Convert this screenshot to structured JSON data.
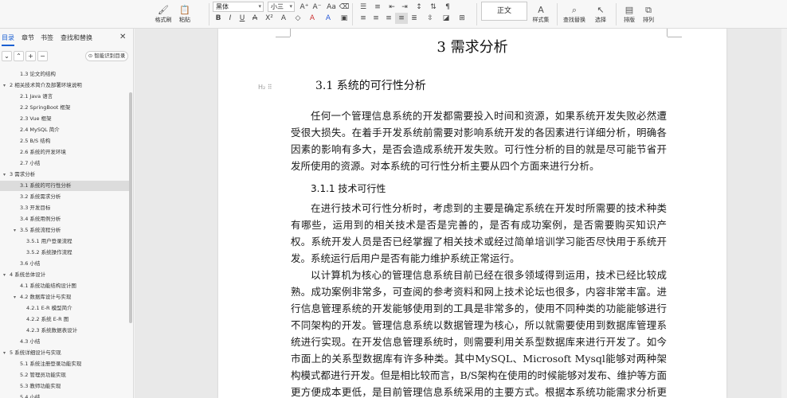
{
  "ribbon": {
    "format_painter": "格式刷",
    "paste": "粘贴",
    "font_name": "黑体",
    "font_size": "小三",
    "style_current": "正文",
    "style_set": "样式集",
    "find_replace": "查找替换",
    "select": "选择",
    "arrange_layout": "排版",
    "arrange": "排列"
  },
  "nav": {
    "tabs": [
      "目录",
      "章节",
      "书签",
      "查找和替换"
    ],
    "smart_toc": "智能识别目录",
    "toc": [
      {
        "label": "1.3 论文的结构",
        "level": 2
      },
      {
        "label": "2 相关技术简介及部署环境说明",
        "level": 1
      },
      {
        "label": "2.1 Java 语言",
        "level": 2
      },
      {
        "label": "2.2 SpringBoot 框架",
        "level": 2
      },
      {
        "label": "2.3 Vue 框架",
        "level": 2
      },
      {
        "label": "2.4 MySQL 简介",
        "level": 2
      },
      {
        "label": "2.5 B/S 结构",
        "level": 2
      },
      {
        "label": "2.6 系统的开发环境",
        "level": 2
      },
      {
        "label": "2.7 小结",
        "level": 2
      },
      {
        "label": "3 需求分析",
        "level": 1
      },
      {
        "label": "3.1 系统的可行性分析",
        "level": 2,
        "selected": true
      },
      {
        "label": "3.2 系统需求分析",
        "level": 2
      },
      {
        "label": "3.3 开发目标",
        "level": 2
      },
      {
        "label": "3.4  系统用例分析",
        "level": 2
      },
      {
        "label": "3.5 系统流程分析",
        "level": 2,
        "expandable": true
      },
      {
        "label": "3.5.1  用户登录流程",
        "level": 3
      },
      {
        "label": "3.5.2  系统操作流程",
        "level": 3
      },
      {
        "label": "3.6 小结",
        "level": 2
      },
      {
        "label": "4 系统总体设计",
        "level": 1
      },
      {
        "label": "4.1 系统功能结构设计图",
        "level": 2
      },
      {
        "label": "4.2  数据库设计与实现",
        "level": 2,
        "expandable": true
      },
      {
        "label": "4.2.1   E-R 模型简介",
        "level": 3
      },
      {
        "label": "4.2.2    系统 E-R 图",
        "level": 3
      },
      {
        "label": "4.2.3   系统数据表设计",
        "level": 3
      },
      {
        "label": "4.3 小结",
        "level": 2
      },
      {
        "label": "5 系统详细设计与实现",
        "level": 1
      },
      {
        "label": "5.1 系统注册登录功能实现",
        "level": 2
      },
      {
        "label": "5.2 管理员功能实现",
        "level": 2
      },
      {
        "label": "5.3 教师功能实现",
        "level": 2
      },
      {
        "label": "5.4 小结",
        "level": 2
      }
    ]
  },
  "document": {
    "chapter_title": "3  需求分析",
    "section_title": "3.1 系统的可行性分析",
    "heading_marker": "H₂",
    "para1": "任何一个管理信息系统的开发都需要投入时间和资源，如果系统开发失败必然遭受很大损失。在着手开发系统前需要对影响系统开发的各因素进行详细分析，明确各因素的影响有多大，是否会造成系统开发失败。可行性分析的目的就是尽可能节省开发所使用的资源。对本系统的可行性分析主要从四个方面来进行分析。",
    "subsection_title": "3.1.1    技术可行性",
    "para2": "在进行技术可行性分析时，考虑到的主要是确定系统在开发时所需要的技术种类有哪些，运用到的相关技术是否是完善的，是否有成功案例，是否需要购买知识产权。系统开发人员是否已经掌握了相关技术或经过简单培训学习能否尽快用于系统开发。系统运行后用户是否有能力维护系统正常运行。",
    "para3": "以计算机为核心的管理信息系统目前已经在很多领域得到运用，技术已经比较成熟。成功案例非常多，可查阅的参考资料和网上技术论坛也很多，内容非常丰富。进行信息管理系统的开发能够使用到的工具是非常多的，使用不同种类的功能能够进行不同架构的开发。管理信息系统以数据管理为核心，所以就需要使用到数据库管理系统进行实现。在开发信息管理系统时，则需要利用关系型数据库来进行开发了。如今市面上的关系型数据库有许多种类。其中MySQL、Microsoft Mysql能够对两种架构模式都进行开发。但是相比较而言，B/S架构在使用的时候能够对发布、维护等方面更方便成本更低，是目前管理信息系统采用的主要方式。根据本系统功能需求分析更适"
  }
}
